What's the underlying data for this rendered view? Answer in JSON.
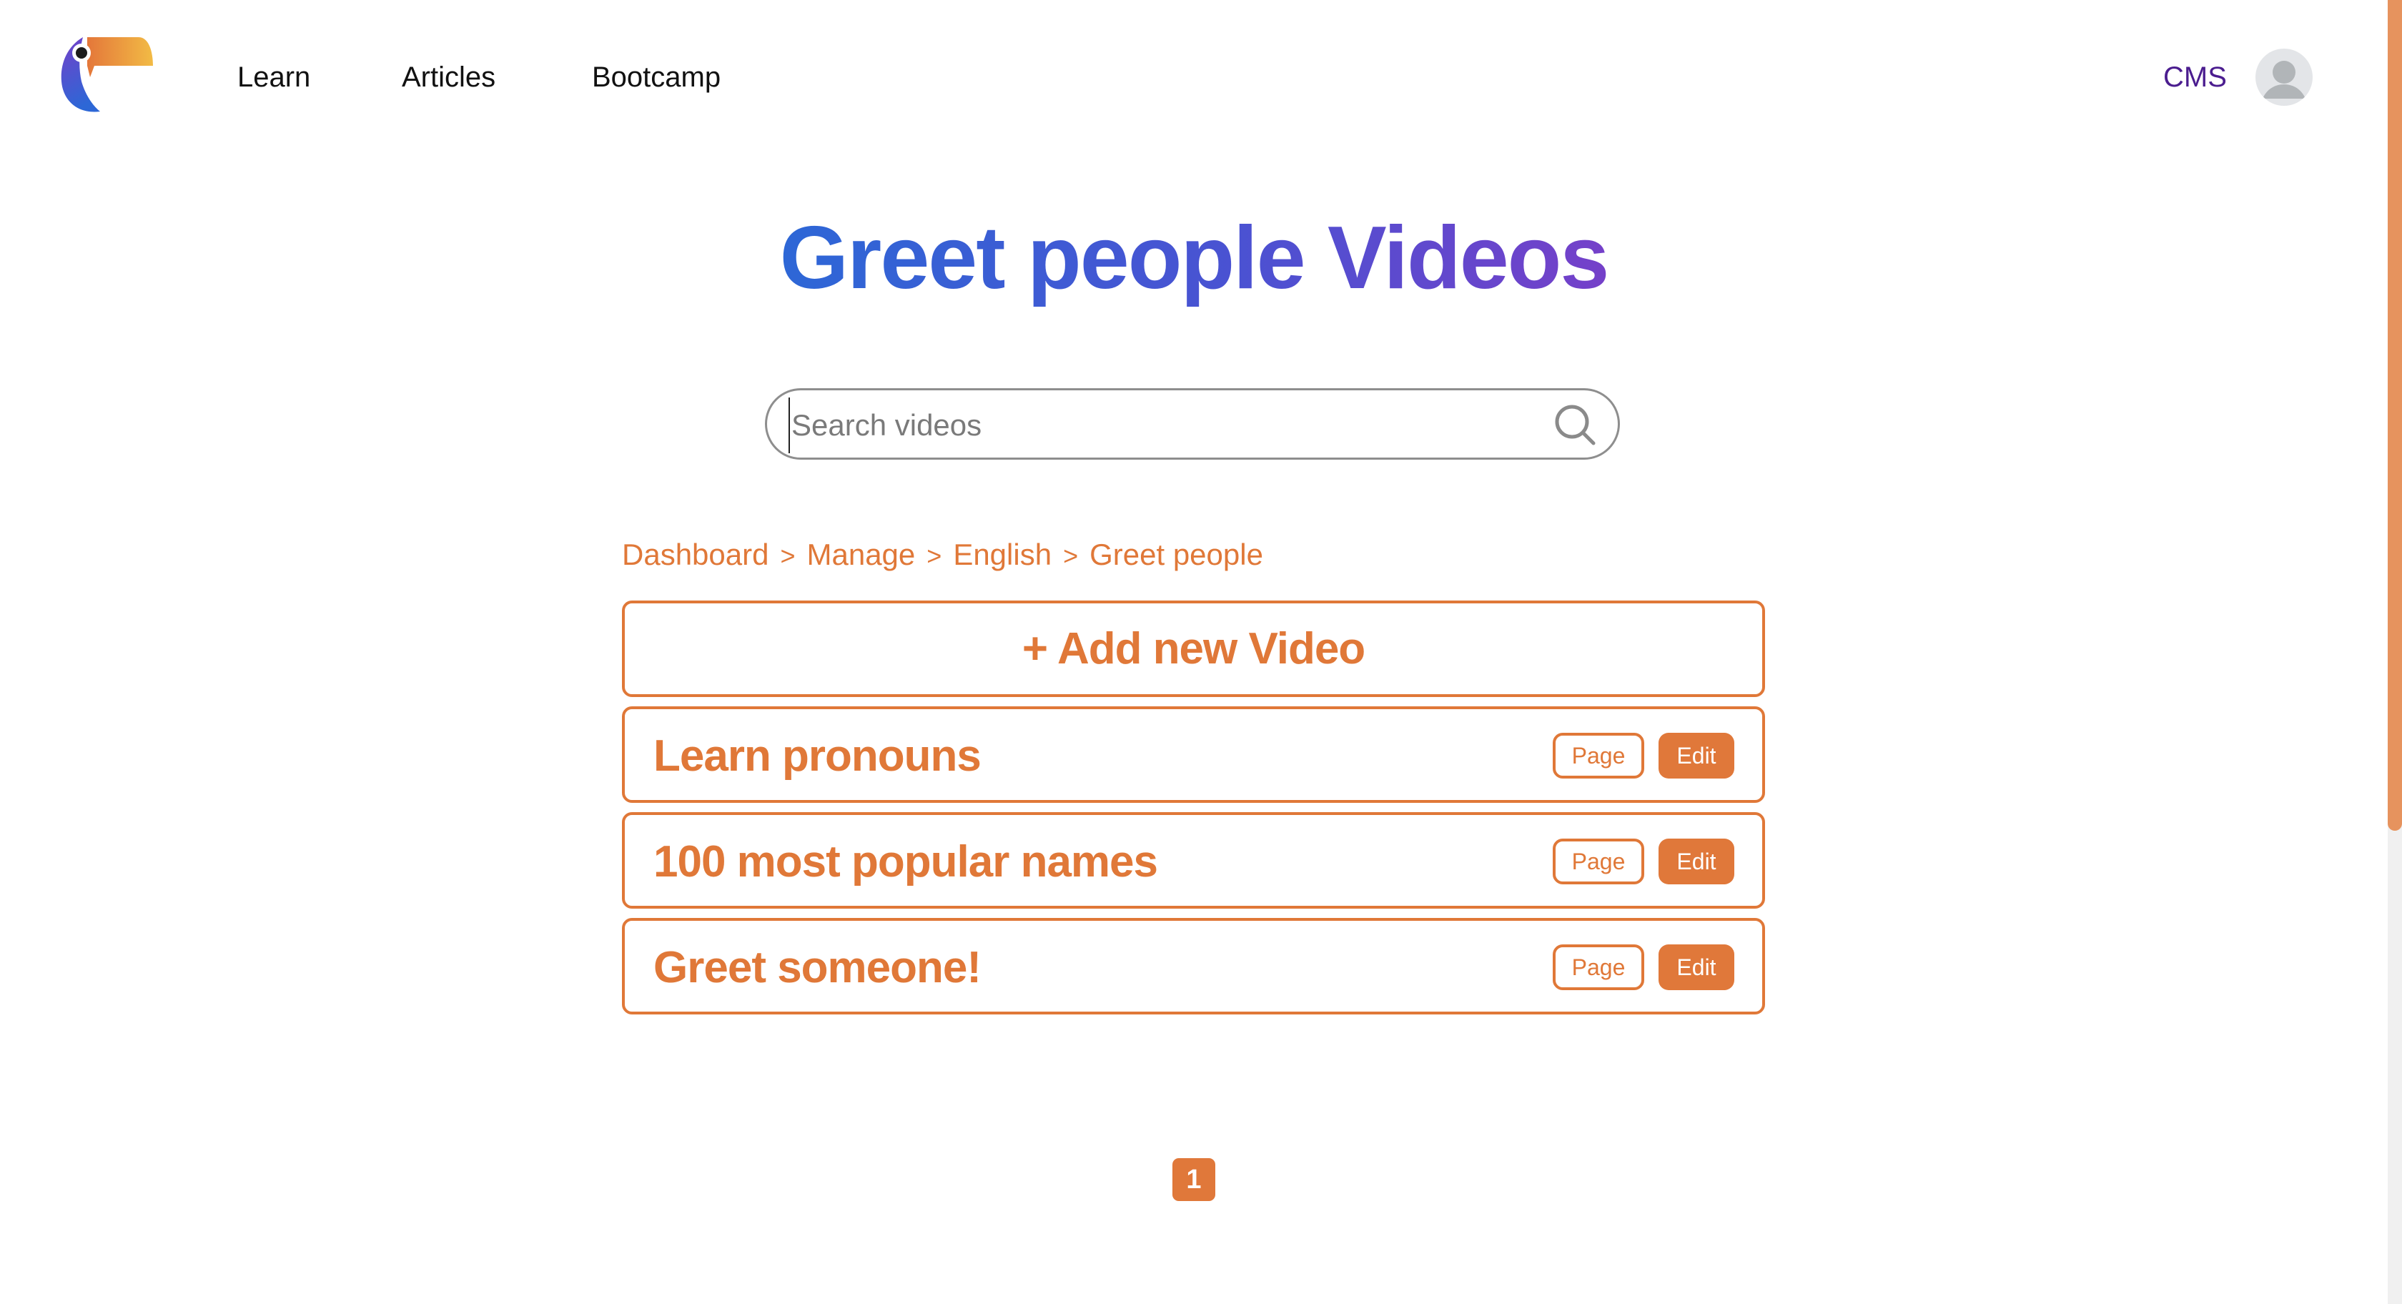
{
  "header": {
    "logo_name": "toucan-logo",
    "nav": [
      {
        "label": "Learn"
      },
      {
        "label": "Articles"
      },
      {
        "label": "Bootcamp"
      }
    ],
    "cms_label": "CMS",
    "avatar_icon": "user-avatar-icon"
  },
  "page": {
    "title": "Greet people Videos",
    "search": {
      "placeholder": "Search videos",
      "value": "",
      "icon": "search-icon"
    },
    "breadcrumb": [
      {
        "label": "Dashboard"
      },
      {
        "label": "Manage"
      },
      {
        "label": "English"
      },
      {
        "label": "Greet people"
      }
    ],
    "breadcrumb_separator": ">",
    "add_label": "+ Add new Video",
    "videos": [
      {
        "title": "Learn pronouns",
        "page_label": "Page",
        "edit_label": "Edit"
      },
      {
        "title": "100 most popular names",
        "page_label": "Page",
        "edit_label": "Edit"
      },
      {
        "title": "Greet someone!",
        "page_label": "Page",
        "edit_label": "Edit"
      }
    ],
    "pagination": {
      "current": "1"
    }
  },
  "colors": {
    "accent": "#e07838",
    "title_gradient_start": "#2d67d6",
    "title_gradient_end": "#7540c9",
    "cms": "#4b1d8f",
    "scrollbar_thumb": "#e6935e"
  }
}
